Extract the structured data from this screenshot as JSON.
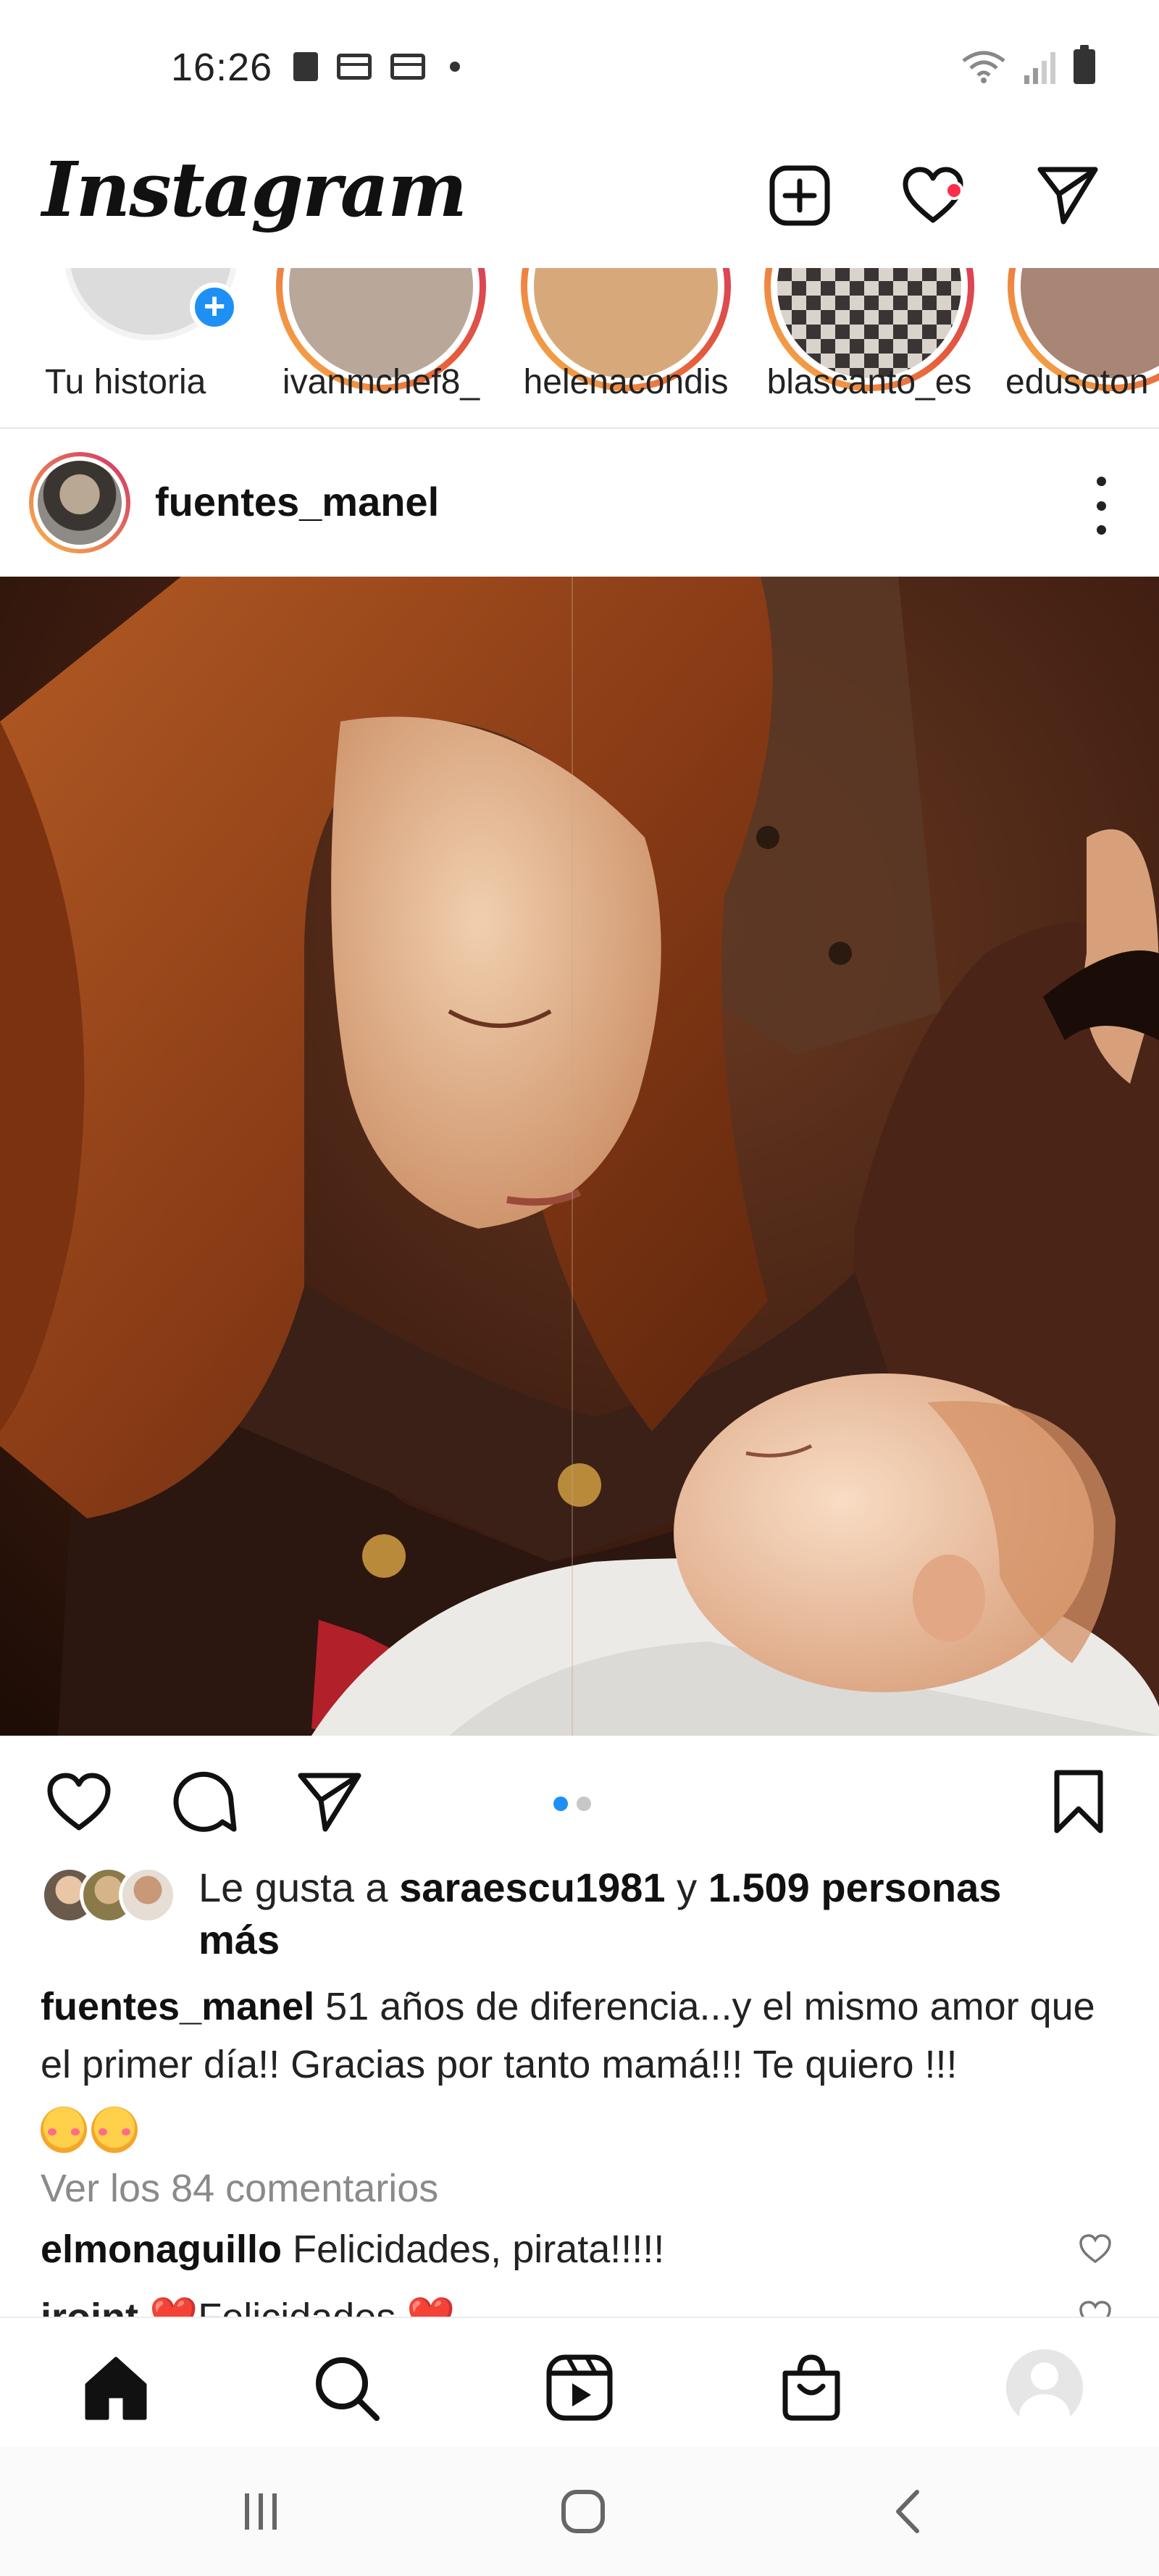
{
  "status_bar": {
    "time": "16:26",
    "left_icons": [
      "sd-card-icon",
      "news-icon",
      "news-icon",
      "dot-icon"
    ],
    "right_icons": [
      "wifi-icon",
      "signal-icon",
      "battery-icon"
    ]
  },
  "header": {
    "logo": "Instagram",
    "icons": [
      "add-post-icon",
      "heart-icon",
      "direct-message-icon"
    ],
    "notification_color": "#ff2d4a"
  },
  "stories": [
    {
      "label": "Tu historia",
      "own": true
    },
    {
      "label": "ivanmchef8_",
      "color": "#b9a89a"
    },
    {
      "label": "helenacondis",
      "color": "#d7a97a"
    },
    {
      "label": "blascanto_es",
      "color": "#3a3534"
    },
    {
      "label": "edusoton",
      "color": "#a98575"
    }
  ],
  "post": {
    "username": "fuentes_manel",
    "carousel": {
      "count": 2,
      "active": 1
    },
    "likes": {
      "prefix": "Le gusta a ",
      "user": "saraescu1981",
      "middle": " y ",
      "count_text": "1.509 personas",
      "suffix_line": "más"
    },
    "caption": {
      "username": "fuentes_manel",
      "text": "51 años de diferencia...y el mismo amor que el primer día!! Gracias por tanto mamá!!! Te quiero !!!",
      "emoji_count": 2
    },
    "view_comments": "Ver los 84 comentarios",
    "comments": [
      {
        "username": "elmonaguillo",
        "text": "Felicidades, pirata!!!!!"
      },
      {
        "username": "jroint",
        "text": "❤️Felicidades ❤️"
      }
    ]
  },
  "bottom_nav": [
    "home-icon",
    "search-icon",
    "reels-icon",
    "shop-icon",
    "profile-avatar"
  ],
  "system_nav": [
    "recent-apps-icon",
    "home-circle-icon",
    "back-icon"
  ],
  "colors": {
    "accent_blue": "#1e90f5",
    "story_gradient_start": "#f9b64a",
    "story_gradient_end": "#d0326a",
    "muted_text": "#8a8a8a"
  }
}
